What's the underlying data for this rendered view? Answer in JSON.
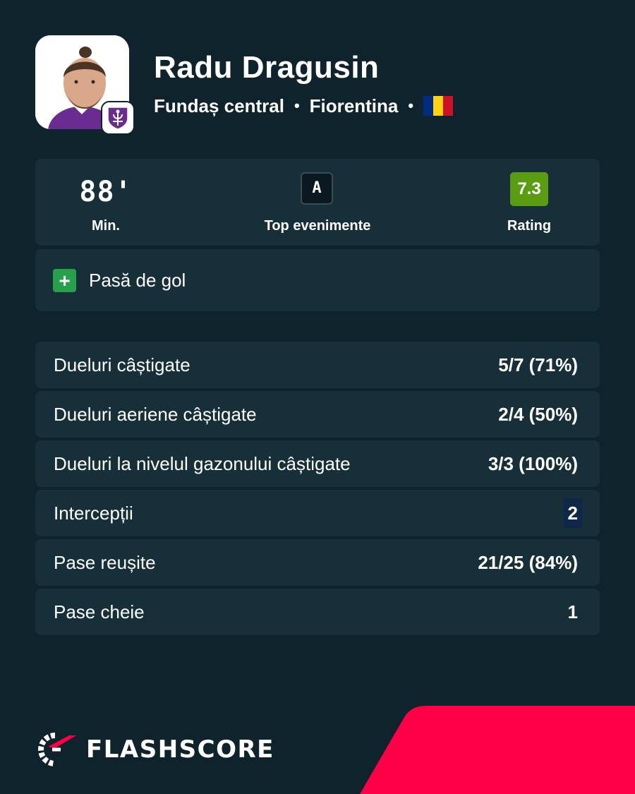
{
  "player": {
    "name": "Radu Dragusin",
    "position": "Fundaș central",
    "team": "Fiorentina",
    "separator": "•",
    "flag_colors": [
      "#002b7f",
      "#fcd116",
      "#ce1126"
    ]
  },
  "summary": {
    "minutes_value": "88'",
    "minutes_label": "Min.",
    "top_events_badge": "A",
    "top_events_label": "Top evenimente",
    "rating_value": "7.3",
    "rating_label": "Rating"
  },
  "event": {
    "icon": "plus-icon",
    "label": "Pasă de gol"
  },
  "stats": [
    {
      "label": "Dueluri câștigate",
      "value": "5/7 (71%)"
    },
    {
      "label": "Dueluri aeriene câștigate",
      "value": "2/4 (50%)"
    },
    {
      "label": "Dueluri la nivelul gazonului câștigate",
      "value": "3/3 (100%)"
    },
    {
      "label": "Intercepții",
      "value": "2"
    },
    {
      "label": "Pase reușite",
      "value": "21/25 (84%)"
    },
    {
      "label": "Pase cheie",
      "value": "1"
    }
  ],
  "brand": {
    "logo_text": "FLASHSCORE",
    "accent": "#ff0046",
    "rating_color": "#5a9c12",
    "background": "#0e232c"
  }
}
